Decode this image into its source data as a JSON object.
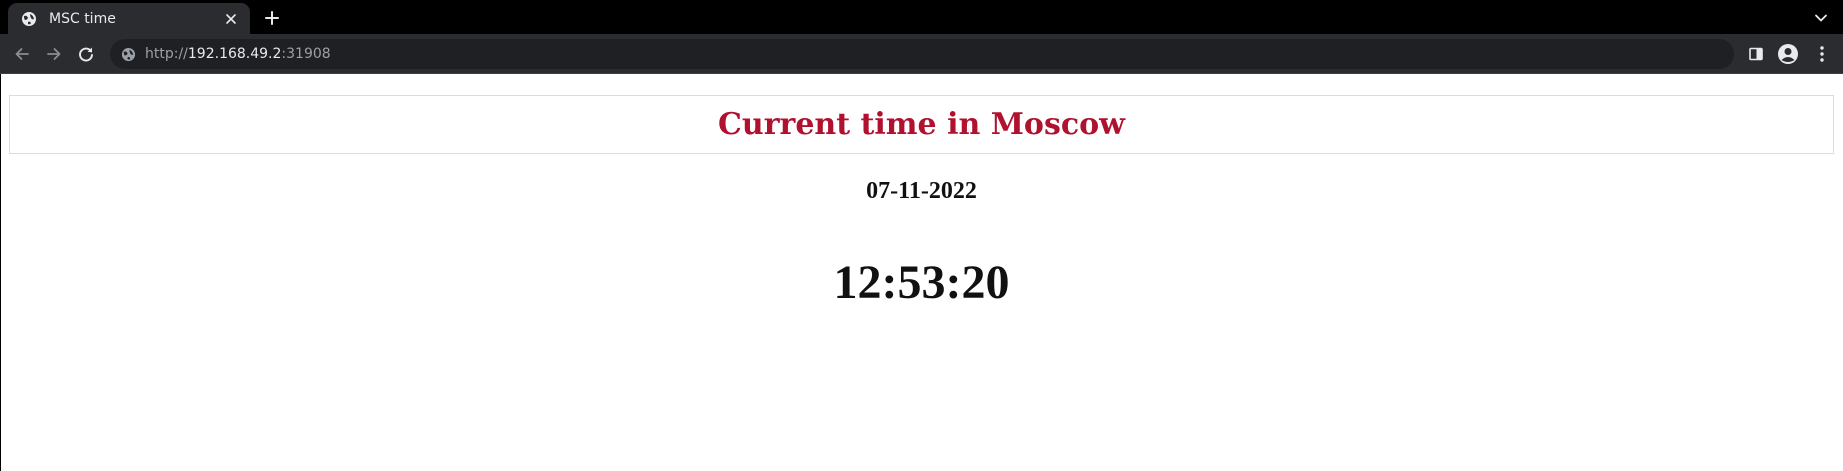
{
  "browser": {
    "tab": {
      "title": "MSC time",
      "favicon": "globe-icon"
    },
    "address_bar": {
      "scheme": "http://",
      "host": "192.168.49.2",
      "port": ":31908",
      "icon": "site-info-icon"
    },
    "icons": {
      "back": "back-arrow-icon",
      "forward": "forward-arrow-icon",
      "reload": "reload-icon",
      "new_tab": "plus-icon",
      "tab_search": "chevron-down-icon",
      "side_panel": "side-panel-icon",
      "profile": "profile-avatar-icon",
      "menu": "kebab-menu-icon"
    },
    "colors": {
      "tabbar_bg": "#000000",
      "toolbar_bg": "#2b2c2f",
      "omnibox_bg": "#1f2023",
      "icon_color": "#e8eaed",
      "disabled_icon_color": "#8a8d91"
    }
  },
  "page": {
    "heading": "Current time in Moscow",
    "date": "07-11-2022",
    "time": "12:53:20",
    "colors": {
      "heading": "#b0112f",
      "text": "#111111",
      "header_border": "#dcdcdc"
    }
  }
}
